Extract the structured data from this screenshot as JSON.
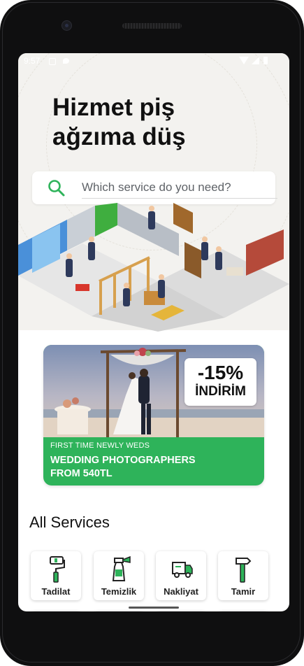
{
  "status_bar": {
    "time": "9:57"
  },
  "hero": {
    "headline_line1": "Hizmet piş",
    "headline_line2": "ağzıma düş"
  },
  "search": {
    "placeholder": "Which service do you need?"
  },
  "promo": {
    "discount_value": "-15%",
    "discount_label": "İNDİRİM",
    "subtitle": "FIRST TIME NEWLY WEDS",
    "title": "WEDDING PHOTOGRAPHERS FROM 540TL"
  },
  "services_section": {
    "title": "All Services",
    "items": [
      {
        "label": "Tadilat",
        "icon": "paint-roller-icon"
      },
      {
        "label": "Temizlik",
        "icon": "spray-bottle-icon"
      },
      {
        "label": "Nakliyat",
        "icon": "moving-truck-icon"
      },
      {
        "label": "Tamir",
        "icon": "hammer-icon"
      }
    ]
  },
  "colors": {
    "accent_green": "#2eb35a",
    "hero_background": "#f3f2ef",
    "phone_frame": "#0f0f10"
  }
}
